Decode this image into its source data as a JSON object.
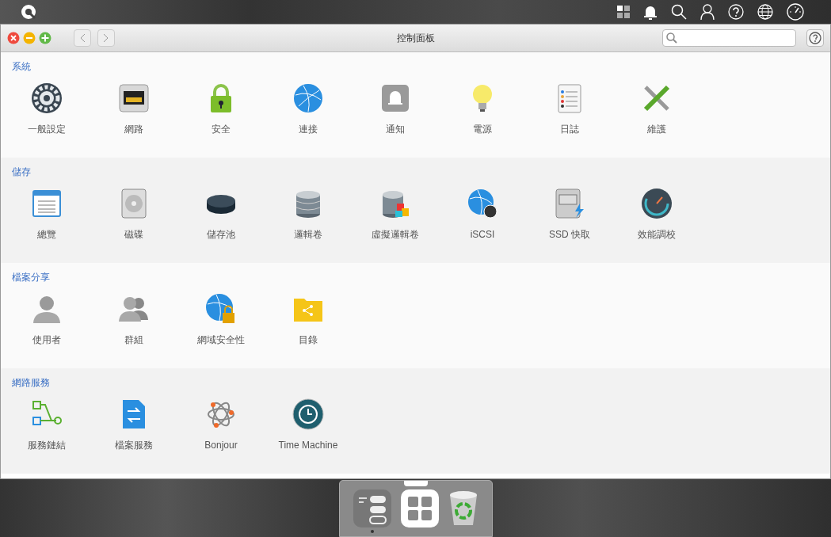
{
  "window": {
    "title": "控制面板"
  },
  "sections": [
    {
      "title": "系統",
      "items": [
        {
          "label": "一般設定",
          "kind": "gear"
        },
        {
          "label": "網路",
          "kind": "port"
        },
        {
          "label": "安全",
          "kind": "lock"
        },
        {
          "label": "連接",
          "kind": "globe"
        },
        {
          "label": "通知",
          "kind": "bell"
        },
        {
          "label": "電源",
          "kind": "bulb"
        },
        {
          "label": "日誌",
          "kind": "notepad"
        },
        {
          "label": "維護",
          "kind": "tools"
        }
      ]
    },
    {
      "title": "儲存",
      "items": [
        {
          "label": "總覽",
          "kind": "overview"
        },
        {
          "label": "磁碟",
          "kind": "disk"
        },
        {
          "label": "儲存池",
          "kind": "pool"
        },
        {
          "label": "邏輯卷",
          "kind": "stack"
        },
        {
          "label": "虛擬邏輯卷",
          "kind": "virtual"
        },
        {
          "label": "iSCSI",
          "kind": "iscsi"
        },
        {
          "label": "SSD 快取",
          "kind": "ssd"
        },
        {
          "label": "效能調校",
          "kind": "gauge"
        }
      ]
    },
    {
      "title": "檔案分享",
      "items": [
        {
          "label": "使用者",
          "kind": "user"
        },
        {
          "label": "群組",
          "kind": "group"
        },
        {
          "label": "網域安全性",
          "kind": "domain"
        },
        {
          "label": "目錄",
          "kind": "folder"
        }
      ]
    },
    {
      "title": "網路服務",
      "items": [
        {
          "label": "服務鏈結",
          "kind": "flow"
        },
        {
          "label": "檔案服務",
          "kind": "file"
        },
        {
          "label": "Bonjour",
          "kind": "bonjour"
        },
        {
          "label": "Time Machine",
          "kind": "clock"
        }
      ]
    }
  ],
  "dock": [
    {
      "kind": "control",
      "running": true
    },
    {
      "kind": "apps",
      "running": false
    },
    {
      "kind": "trash",
      "running": false
    }
  ]
}
